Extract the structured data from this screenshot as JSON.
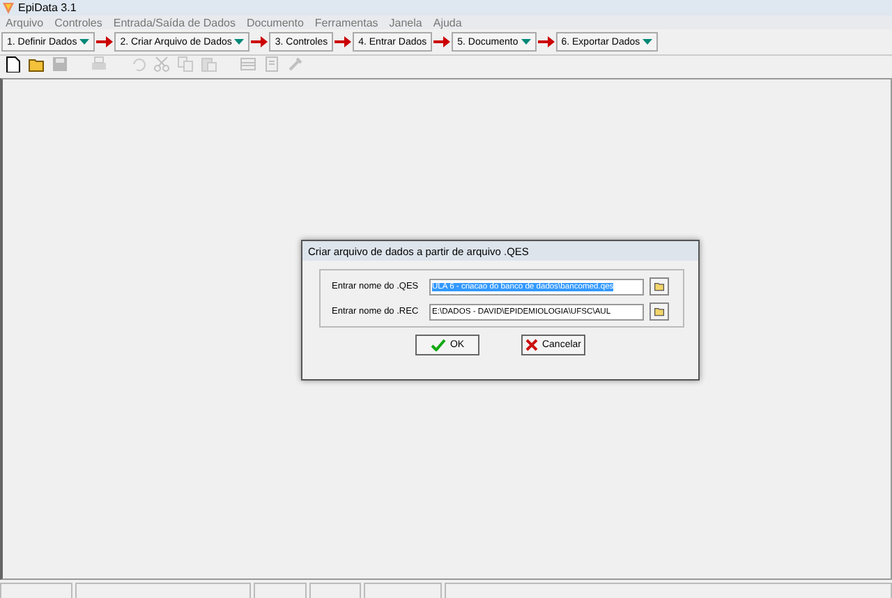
{
  "window": {
    "title": "EpiData 3.1"
  },
  "menu": [
    "Arquivo",
    "Controles",
    "Entrada/Saída de Dados",
    "Documento",
    "Ferramentas",
    "Janela",
    "Ajuda"
  ],
  "workflow": [
    {
      "label": "1. Definir Dados",
      "dropdown": true
    },
    {
      "label": "2. Criar Arquivo de Dados",
      "dropdown": true
    },
    {
      "label": "3. Controles",
      "dropdown": false
    },
    {
      "label": "4. Entrar Dados",
      "dropdown": false
    },
    {
      "label": "5. Documento",
      "dropdown": true
    },
    {
      "label": "6. Exportar Dados",
      "dropdown": true
    }
  ],
  "toolbar": [
    {
      "kind": "new",
      "disabled": false
    },
    {
      "kind": "open",
      "disabled": false
    },
    {
      "kind": "save",
      "disabled": true
    },
    {
      "kind": "sep"
    },
    {
      "kind": "print",
      "disabled": true
    },
    {
      "kind": "sep"
    },
    {
      "kind": "undo",
      "disabled": true
    },
    {
      "kind": "cut",
      "disabled": true
    },
    {
      "kind": "copy",
      "disabled": true
    },
    {
      "kind": "paste",
      "disabled": true
    },
    {
      "kind": "sep"
    },
    {
      "kind": "grid",
      "disabled": true
    },
    {
      "kind": "doc",
      "disabled": true
    },
    {
      "kind": "tool",
      "disabled": true
    }
  ],
  "dialog": {
    "title": "Criar arquivo de dados a partir de arquivo .QES",
    "fields": [
      {
        "label": "Entrar nome do .QES",
        "value": "ULA 6 - criacao do banco de dados\\bancomed.qes",
        "selected": true
      },
      {
        "label": "Entrar nome do .REC",
        "value": "E:\\DADOS - DAVID\\EPIDEMIOLOGIA\\UFSC\\AUL",
        "selected": false
      }
    ],
    "buttons": [
      {
        "kind": "ok",
        "label": "OK"
      },
      {
        "kind": "cancel",
        "label": "Cancelar"
      }
    ]
  }
}
